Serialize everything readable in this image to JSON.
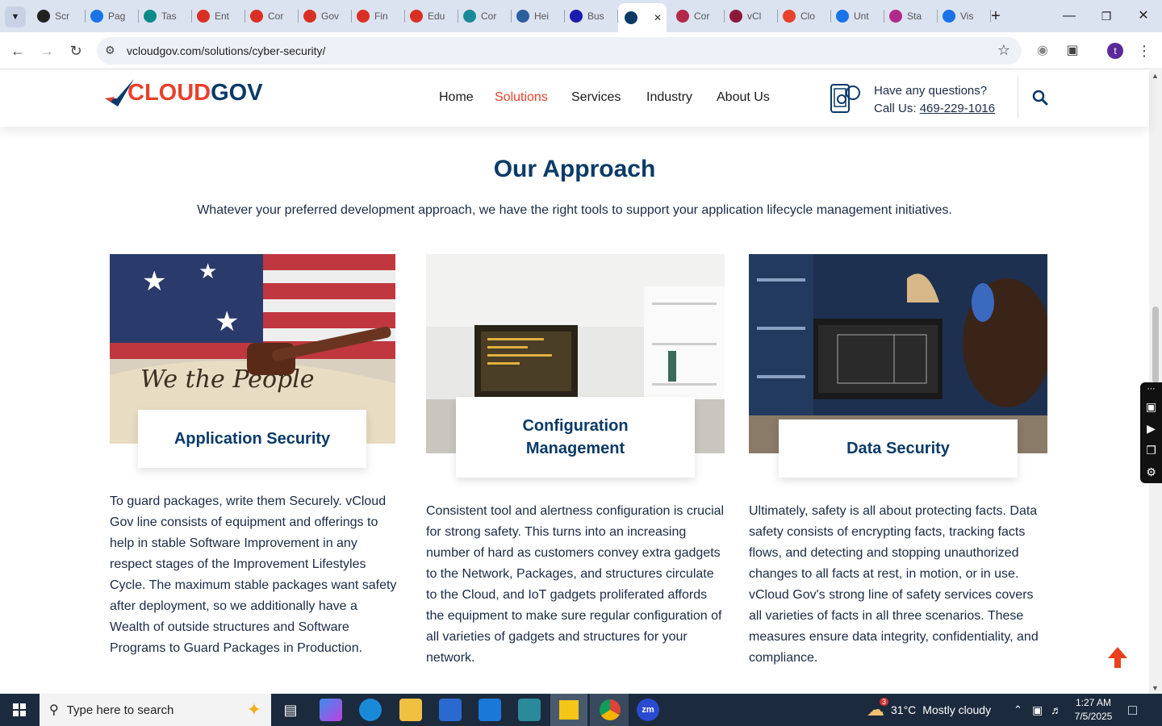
{
  "browser": {
    "tabs": [
      {
        "label": "Scr",
        "color": "#222222"
      },
      {
        "label": "Pag",
        "color": "#1a73e8"
      },
      {
        "label": "Tas",
        "color": "#0b8a8a"
      },
      {
        "label": "Ent",
        "color": "#d93025"
      },
      {
        "label": "Cor",
        "color": "#d93025"
      },
      {
        "label": "Gov",
        "color": "#d93025"
      },
      {
        "label": "Fin",
        "color": "#d93025"
      },
      {
        "label": "Edu",
        "color": "#d93025"
      },
      {
        "label": "Cor",
        "color": "#1a8a9a"
      },
      {
        "label": "Hei",
        "color": "#2b5fa0"
      },
      {
        "label": "Bus",
        "color": "#1b1bb0"
      },
      {
        "label": "",
        "color": "#0b3a68"
      },
      {
        "label": "Cor",
        "color": "#b3294a"
      },
      {
        "label": "vCl",
        "color": "#8b1a3a"
      },
      {
        "label": "Clo",
        "color": "#e8412c"
      },
      {
        "label": "Unt",
        "color": "#1a73e8"
      },
      {
        "label": "Sta",
        "color": "#b02a8a"
      },
      {
        "label": "Vis",
        "color": "#1a73e8"
      }
    ],
    "url": "vcloudgov.com/solutions/cyber-security/",
    "profile_initial": "t"
  },
  "header": {
    "logo_a": "CLOUD",
    "logo_b": "GOV",
    "nav": [
      "Home",
      "Solutions",
      "Services",
      "Industry",
      "About Us"
    ],
    "question": "Have any questions?",
    "call_prefix": "Call Us: ",
    "phone": "469-229-1016"
  },
  "section": {
    "title": "Our Approach",
    "subtitle": "Whatever your preferred development approach, we have the right tools to support your application lifecycle management initiatives."
  },
  "cards": [
    {
      "title": "Application Security",
      "text": "To guard packages, write them Securely. vCloud Gov line consists of equipment and offerings to help in stable Software Improvement in any respect stages of the Improvement Lifestyles Cycle. The maximum stable packages want safety after deployment, so we additionally have a Wealth of outside structures and Software Programs to Guard Packages in Production."
    },
    {
      "title": "Configuration Management",
      "text": "Consistent tool and alertness configuration is crucial for strong safety. This turns into an increasing number of hard as customers convey extra gadgets to the Network, Packages, and structures circulate to the Cloud, and IoT gadgets proliferated affords the equipment to make sure regular configuration of all varieties of gadgets and structures for your network."
    },
    {
      "title": "Data Security",
      "text": "Ultimately, safety is all about protecting facts. Data safety consists of encrypting facts, tracking facts flows, and detecting and stopping unauthorized changes to all facts at rest, in motion, or in use. vCloud Gov's strong line of safety services covers all varieties of facts in all three scenarios. These measures ensure data integrity, confidentiality, and compliance."
    }
  ],
  "taskbar": {
    "search_placeholder": "Type here to search",
    "weather_temp": "31°C",
    "weather_desc": "Mostly cloudy",
    "weather_badge": "3",
    "time": "1:27 AM",
    "date": "7/5/2025"
  }
}
